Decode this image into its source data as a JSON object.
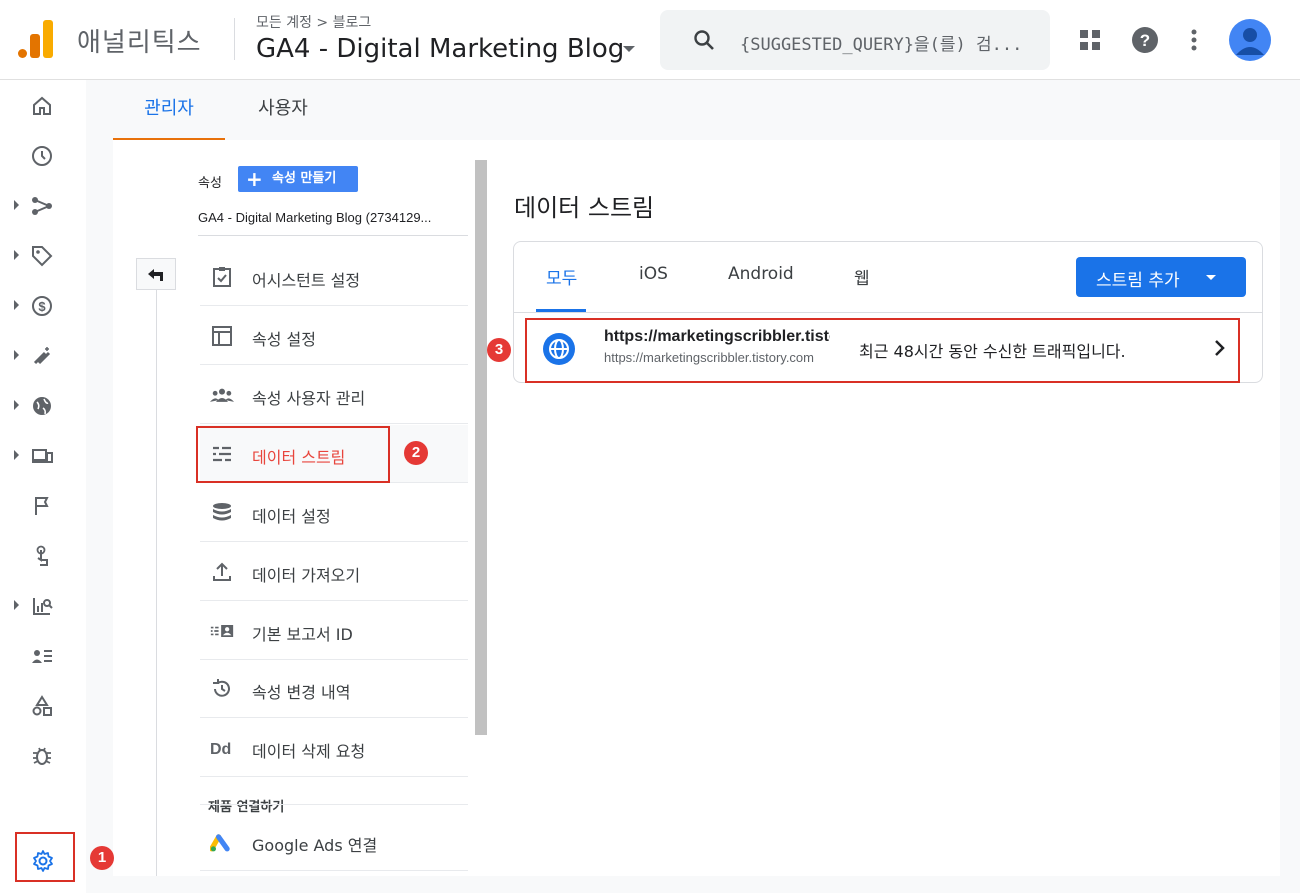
{
  "header": {
    "brand": "애널리틱스",
    "breadcrumb": "모든 계정 > 블로그",
    "property_title": "GA4 - Digital Marketing Blog",
    "search_placeholder": "{SUGGESTED_QUERY}을(를) 검..."
  },
  "admin_tabs": [
    {
      "label": "관리자",
      "active": true
    },
    {
      "label": "사용자",
      "active": false
    }
  ],
  "property_panel": {
    "label": "속성",
    "create_button": "속성 만들기",
    "property_name": "GA4 - Digital Marketing Blog (2734129...",
    "menu": [
      {
        "label": "어시스턴트 설정",
        "icon": "checklist-icon"
      },
      {
        "label": "속성 설정",
        "icon": "layout-icon"
      },
      {
        "label": "속성 사용자 관리",
        "icon": "people-icon"
      },
      {
        "label": "데이터 스트림",
        "icon": "stream-icon",
        "active": true
      },
      {
        "label": "데이터 설정",
        "icon": "database-icon"
      },
      {
        "label": "데이터 가져오기",
        "icon": "upload-icon"
      },
      {
        "label": "기본 보고서 ID",
        "icon": "id-card-icon"
      },
      {
        "label": "속성 변경 내역",
        "icon": "history-icon"
      },
      {
        "label": "데이터 삭제 요청",
        "icon": "dd-icon"
      }
    ],
    "section_label": "제품 연결하기",
    "google_ads": "Google Ads 연결"
  },
  "data_streams": {
    "title": "데이터 스트림",
    "tabs": [
      {
        "label": "모두",
        "active": true
      },
      {
        "label": "iOS"
      },
      {
        "label": "Android"
      },
      {
        "label": "웹"
      }
    ],
    "add_button": "스트림 추가",
    "stream": {
      "name": "https://marketingscribbler.tistory.com",
      "url": "https://marketingscribbler.tistory.com",
      "status": "최근 48시간 동안 수신한 트래픽입니다."
    }
  },
  "annotations": [
    "1",
    "2",
    "3"
  ],
  "colors": {
    "accent": "#1a73e8",
    "highlight": "#e8453c",
    "tab_indicator": "#e8710a",
    "annotation": "#e53935"
  }
}
